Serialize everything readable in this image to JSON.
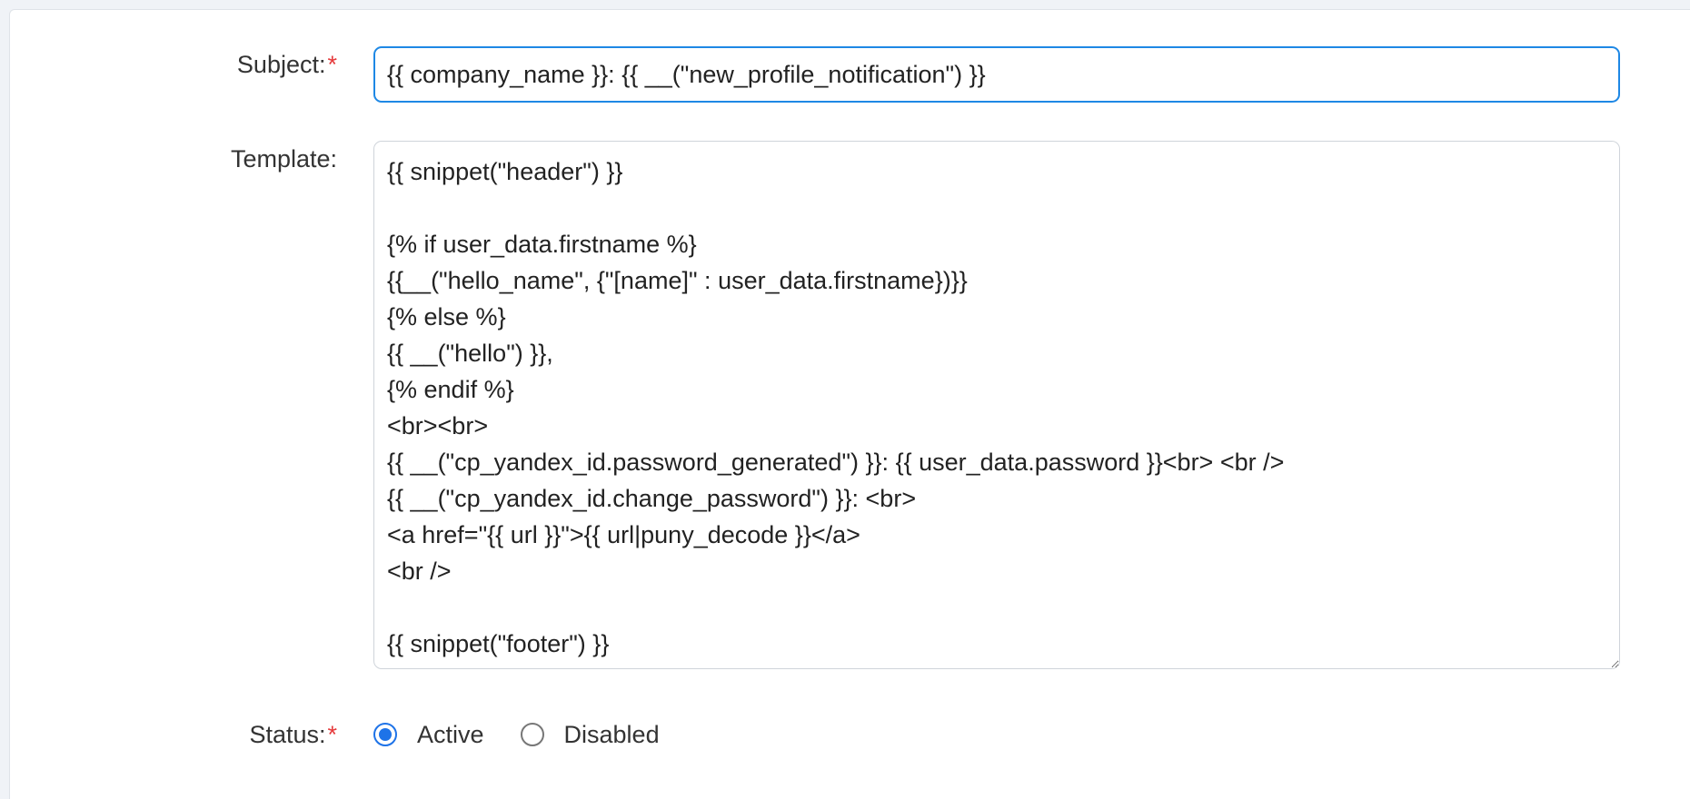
{
  "form": {
    "subject": {
      "label": "Subject:",
      "required_mark": "*",
      "value": "{{ company_name }}: {{ __(\"new_profile_notification\") }}"
    },
    "template": {
      "label": "Template:",
      "value": "{{ snippet(\"header\") }}\n\n{% if user_data.firstname %}\n{{__(\"hello_name\", {\"[name]\" : user_data.firstname})}}\n{% else %}\n{{ __(\"hello\") }},\n{% endif %}\n<br><br>\n{{ __(\"cp_yandex_id.password_generated\") }}: {{ user_data.password }}<br> <br />\n{{ __(\"cp_yandex_id.change_password\") }}: <br>\n<a href=\"{{ url }}\">{{ url|puny_decode }}</a>\n<br />\n\n{{ snippet(\"footer\") }}"
    },
    "status": {
      "label": "Status:",
      "required_mark": "*",
      "options": [
        {
          "label": "Active",
          "checked": true
        },
        {
          "label": "Disabled",
          "checked": false
        }
      ]
    }
  },
  "colors": {
    "accent": "#1e73e8",
    "required": "#e5393b"
  }
}
